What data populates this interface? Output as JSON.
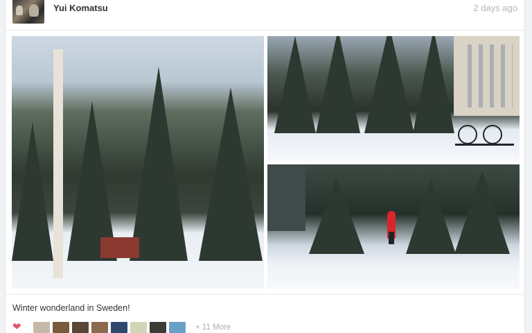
{
  "post": {
    "author": "Yui Komatsu",
    "time_ago": "2 days ago",
    "caption": "Winter wonderland in Sweden!",
    "likes": {
      "likers": [
        {
          "name": "liker-1",
          "color": "#c7b9a8"
        },
        {
          "name": "liker-2",
          "color": "#7a5a3c"
        },
        {
          "name": "liker-3",
          "color": "#5a4636"
        },
        {
          "name": "liker-4",
          "color": "#8c6a4e"
        },
        {
          "name": "liker-5",
          "color": "#2d4a6e"
        },
        {
          "name": "liker-6",
          "color": "#cfd6b8"
        },
        {
          "name": "liker-7",
          "color": "#3e3a36"
        },
        {
          "name": "liker-8",
          "color": "#6aa0c8"
        }
      ],
      "more_label": "+ 11 More"
    }
  },
  "colors": {
    "heart": "#e0556b",
    "muted": "#b2b5bb",
    "text": "#333333"
  },
  "icons": {
    "heart": "heart-icon"
  }
}
